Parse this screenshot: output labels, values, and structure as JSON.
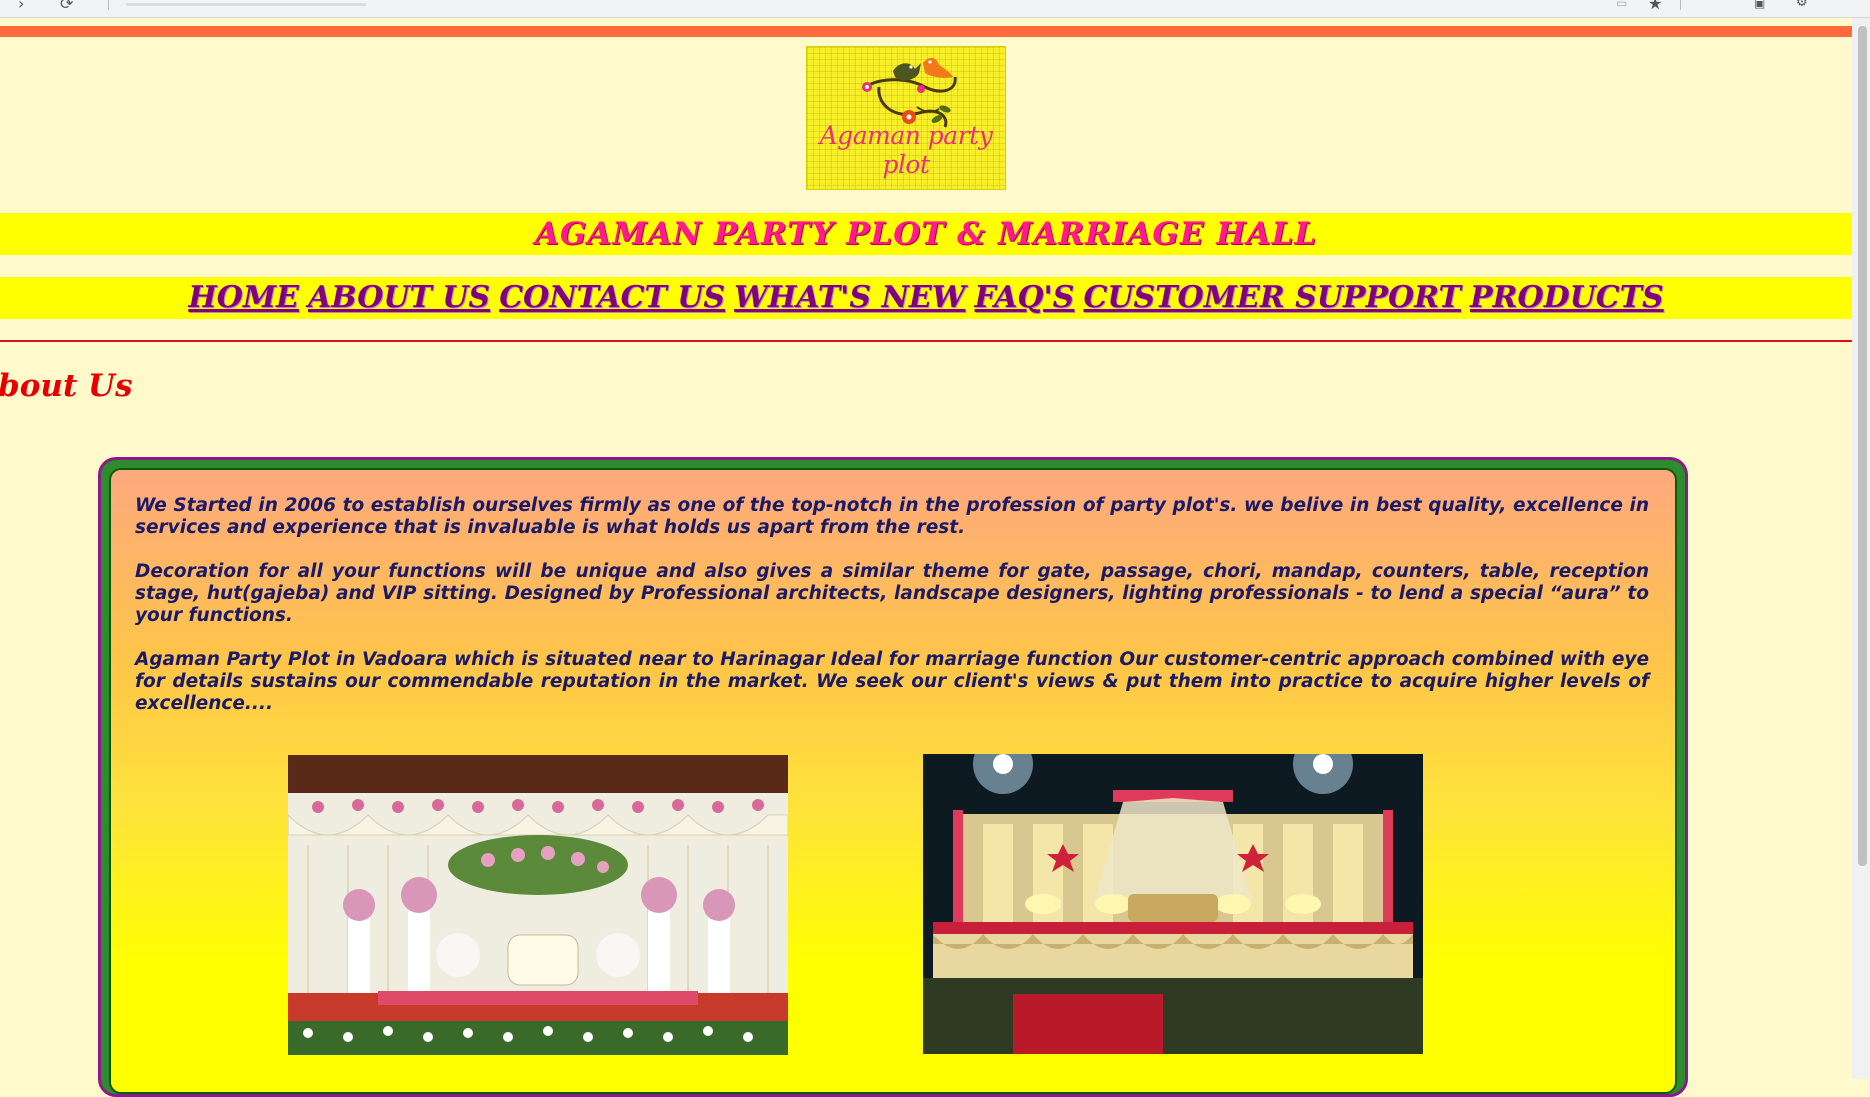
{
  "browser": {
    "back_glyph": "›",
    "reload_glyph": "⟳",
    "star_glyph": "★"
  },
  "logo": {
    "text": "Agaman party plot"
  },
  "site": {
    "title": "AGAMAN PARTY PLOT & MARRIAGE HALL"
  },
  "nav": {
    "items": [
      {
        "label": "HOME"
      },
      {
        "label": "ABOUT US"
      },
      {
        "label": "CONTACT US"
      },
      {
        "label": "WHAT'S NEW"
      },
      {
        "label": "FAQ'S"
      },
      {
        "label": "CUSTOMER SUPPORT"
      },
      {
        "label": "PRODUCTS"
      }
    ]
  },
  "page": {
    "heading": "About Us",
    "paragraphs": [
      "We Started in 2006 to establish ourselves firmly as one of the top-notch in the profession of party plot's. we belive in best quality, excellence in services and experience that is invaluable is what holds us apart from the rest.",
      "Decoration for all your functions will be unique and also gives a similar theme for gate, passage, chori, mandap, counters, table, reception stage, hut(gajeba) and VIP sitting. Designed by Professional architects, landscape designers, lighting professionals - to lend a special “aura” to your functions.",
      "Agaman Party Plot in Vadoara which is situated near to Harinagar Ideal for marriage function Our customer-centric approach combined with eye for details sustains our commendable reputation in the market. We seek our client's views & put them into practice to acquire higher levels of excellence...."
    ]
  },
  "colors": {
    "page_background": "#fff9cb",
    "top_stripe": "#ff6b3d",
    "band_yellow": "#ffff00",
    "title_pink": "#ff1b8d",
    "nav_purple": "#800080",
    "heading_red": "#e80000",
    "box_border_green": "#2e8b2e",
    "body_text_navy": "#1a1a66"
  }
}
